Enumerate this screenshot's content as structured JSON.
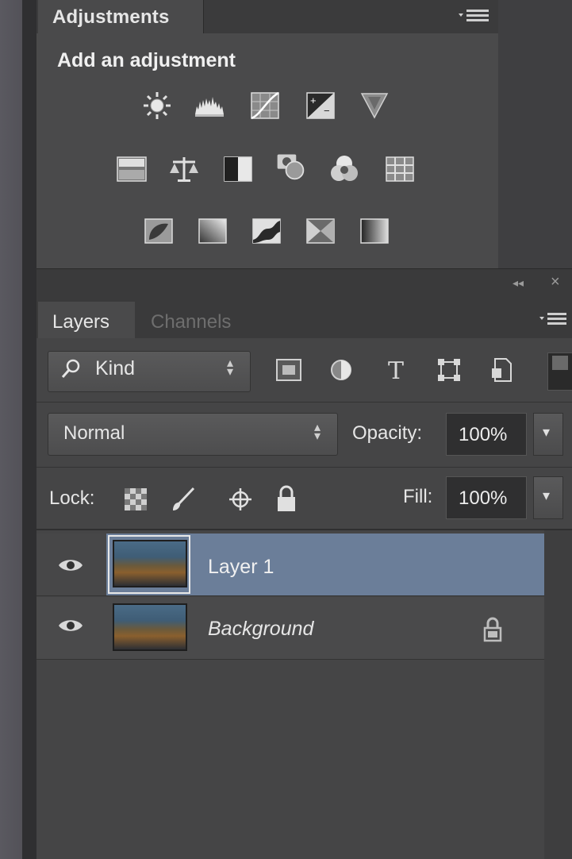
{
  "adjustments": {
    "tab_label": "Adjustments",
    "heading": "Add an adjustment",
    "icons_row1": [
      "brightness-contrast-icon",
      "levels-icon",
      "curves-icon",
      "exposure-icon",
      "vibrance-icon"
    ],
    "icons_row2": [
      "hue-saturation-icon",
      "color-balance-icon",
      "black-white-icon",
      "photo-filter-icon",
      "channel-mixer-icon",
      "color-lookup-icon"
    ],
    "icons_row3": [
      "invert-icon",
      "posterize-icon",
      "threshold-icon",
      "selective-color-icon",
      "gradient-map-icon"
    ]
  },
  "layers_panel": {
    "tabs": [
      {
        "label": "Layers",
        "active": true
      },
      {
        "label": "Channels",
        "active": false
      }
    ],
    "filter": {
      "label": "Kind"
    },
    "blend_mode": "Normal",
    "opacity_label": "Opacity:",
    "opacity_value": "100%",
    "lock_label": "Lock:",
    "fill_label": "Fill:",
    "fill_value": "100%",
    "layers": [
      {
        "name": "Layer 1",
        "selected": true,
        "visible": true
      },
      {
        "name": "Background",
        "selected": false,
        "visible": true,
        "locked": true
      }
    ]
  },
  "colors": {
    "panel": "#4a4a4b",
    "selected_row": "#6b7e99",
    "field_dark": "#2f2f30"
  }
}
